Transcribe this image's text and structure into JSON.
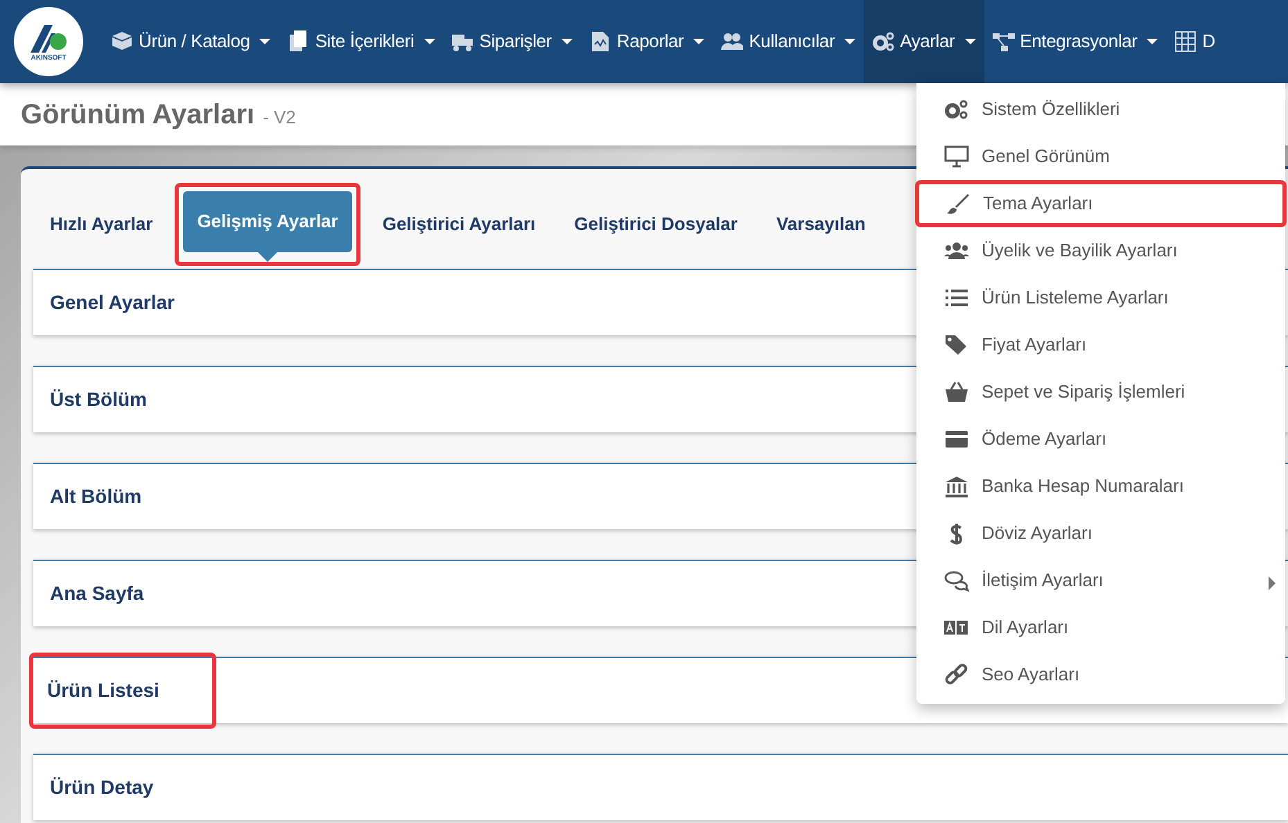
{
  "navbar": {
    "logo_text": "AKINSOFT",
    "items": [
      {
        "label": "Ürün / Katalog",
        "dropdown": true,
        "selected": false
      },
      {
        "label": "Site İçerikleri",
        "dropdown": true,
        "selected": false
      },
      {
        "label": "Siparişler",
        "dropdown": true,
        "selected": false
      },
      {
        "label": "Raporlar",
        "dropdown": true,
        "selected": false
      },
      {
        "label": "Kullanıcılar",
        "dropdown": true,
        "selected": false
      },
      {
        "label": "Ayarlar",
        "dropdown": true,
        "selected": true
      },
      {
        "label": "Entegrasyonlar",
        "dropdown": true,
        "selected": false
      },
      {
        "label": "D",
        "dropdown": false,
        "selected": false
      }
    ]
  },
  "page_header": {
    "title": "Görünüm Ayarları",
    "subtitle": "- V2"
  },
  "tabs": [
    {
      "label": "Hızlı Ayarlar",
      "selected": false,
      "highlighted": false
    },
    {
      "label": "Gelişmiş Ayarlar",
      "selected": true,
      "highlighted": true
    },
    {
      "label": "Geliştirici Ayarları",
      "selected": false,
      "highlighted": false
    },
    {
      "label": "Geliştirici Dosyalar",
      "selected": false,
      "highlighted": false
    },
    {
      "label": "Varsayılan",
      "selected": false,
      "highlighted": false
    }
  ],
  "panels": [
    {
      "title": "Genel Ayarlar",
      "highlighted": false
    },
    {
      "title": "Üst Bölüm",
      "highlighted": false
    },
    {
      "title": "Alt Bölüm",
      "highlighted": false
    },
    {
      "title": "Ana Sayfa",
      "highlighted": false
    },
    {
      "title": "Ürün Listesi",
      "highlighted": true
    },
    {
      "title": "Ürün Detay",
      "highlighted": false
    }
  ],
  "dropdown_menu": {
    "items": [
      {
        "label": "Sistem Özellikleri",
        "highlighted": false,
        "submenu": false
      },
      {
        "label": "Genel Görünüm",
        "highlighted": false,
        "submenu": false
      },
      {
        "label": "Tema Ayarları",
        "highlighted": true,
        "submenu": false
      },
      {
        "label": "Üyelik ve Bayilik Ayarları",
        "highlighted": false,
        "submenu": false
      },
      {
        "label": "Ürün Listeleme Ayarları",
        "highlighted": false,
        "submenu": false
      },
      {
        "label": "Fiyat Ayarları",
        "highlighted": false,
        "submenu": false
      },
      {
        "label": "Sepet ve Sipariş İşlemleri",
        "highlighted": false,
        "submenu": false
      },
      {
        "label": "Ödeme Ayarları",
        "highlighted": false,
        "submenu": false
      },
      {
        "label": "Banka Hesap Numaraları",
        "highlighted": false,
        "submenu": false
      },
      {
        "label": "Döviz Ayarları",
        "highlighted": false,
        "submenu": false
      },
      {
        "label": "İletişim Ayarları",
        "highlighted": false,
        "submenu": true
      },
      {
        "label": "Dil Ayarları",
        "highlighted": false,
        "submenu": false
      },
      {
        "label": "Seo Ayarları",
        "highlighted": false,
        "submenu": false
      }
    ]
  }
}
